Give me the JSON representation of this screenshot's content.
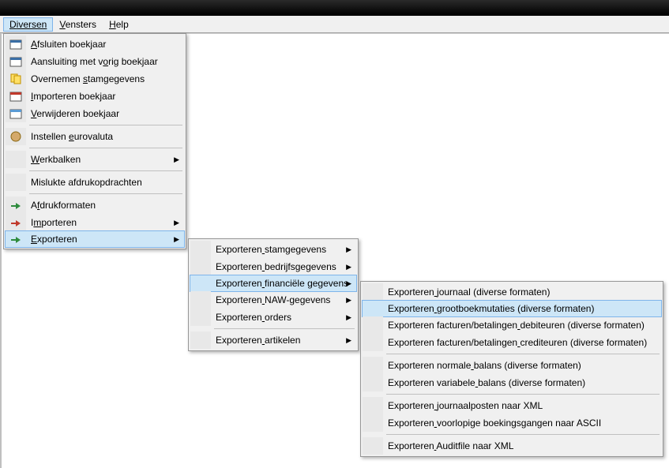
{
  "menubar": {
    "diversen": "Diversen",
    "vensters": "Vensters",
    "help": "Help"
  },
  "menu_diversen": {
    "afsluiten": "Afsluiten boekjaar",
    "aansluiting": "Aansluiting met vorig boekjaar",
    "overnemen": "Overnemen stamgegevens",
    "importeren_boekjaar": "Importeren boekjaar",
    "verwijderen_boekjaar": "Verwijderen boekjaar",
    "instellen_euro": "Instellen eurovaluta",
    "werkbalken": "Werkbalken",
    "mislukte": "Mislukte afdrukopdrachten",
    "afdrukformaten": "Afdrukformaten",
    "importeren": "Importeren",
    "exporteren": "Exporteren"
  },
  "menu_exporteren": {
    "stamgegevens": "Exporteren stamgegevens",
    "bedrijfsgegevens": "Exporteren bedrijfsgegevens",
    "financiele": "Exporteren financiële gegevens",
    "naw": "Exporteren NAW-gegevens",
    "orders": "Exporteren orders",
    "artikelen": "Exporteren artikelen"
  },
  "menu_financieel": {
    "journaal": "Exporteren journaal (diverse formaten)",
    "grootboek": "Exporteren grootboekmutaties (diverse formaten)",
    "debiteuren": "Exporteren facturen/betalingen debiteuren (diverse formaten)",
    "crediteuren": "Exporteren facturen/betalingen crediteuren (diverse formaten)",
    "normale_balans": "Exporteren normale balans (diverse formaten)",
    "variabele_balans": "Exporteren variabele balans (diverse formaten)",
    "journaalposten_xml": "Exporteren journaalposten naar XML",
    "voorlopige_ascii": "Exporteren voorlopige boekingsgangen naar ASCII",
    "auditfile_xml": "Exporteren Auditfile naar XML"
  }
}
